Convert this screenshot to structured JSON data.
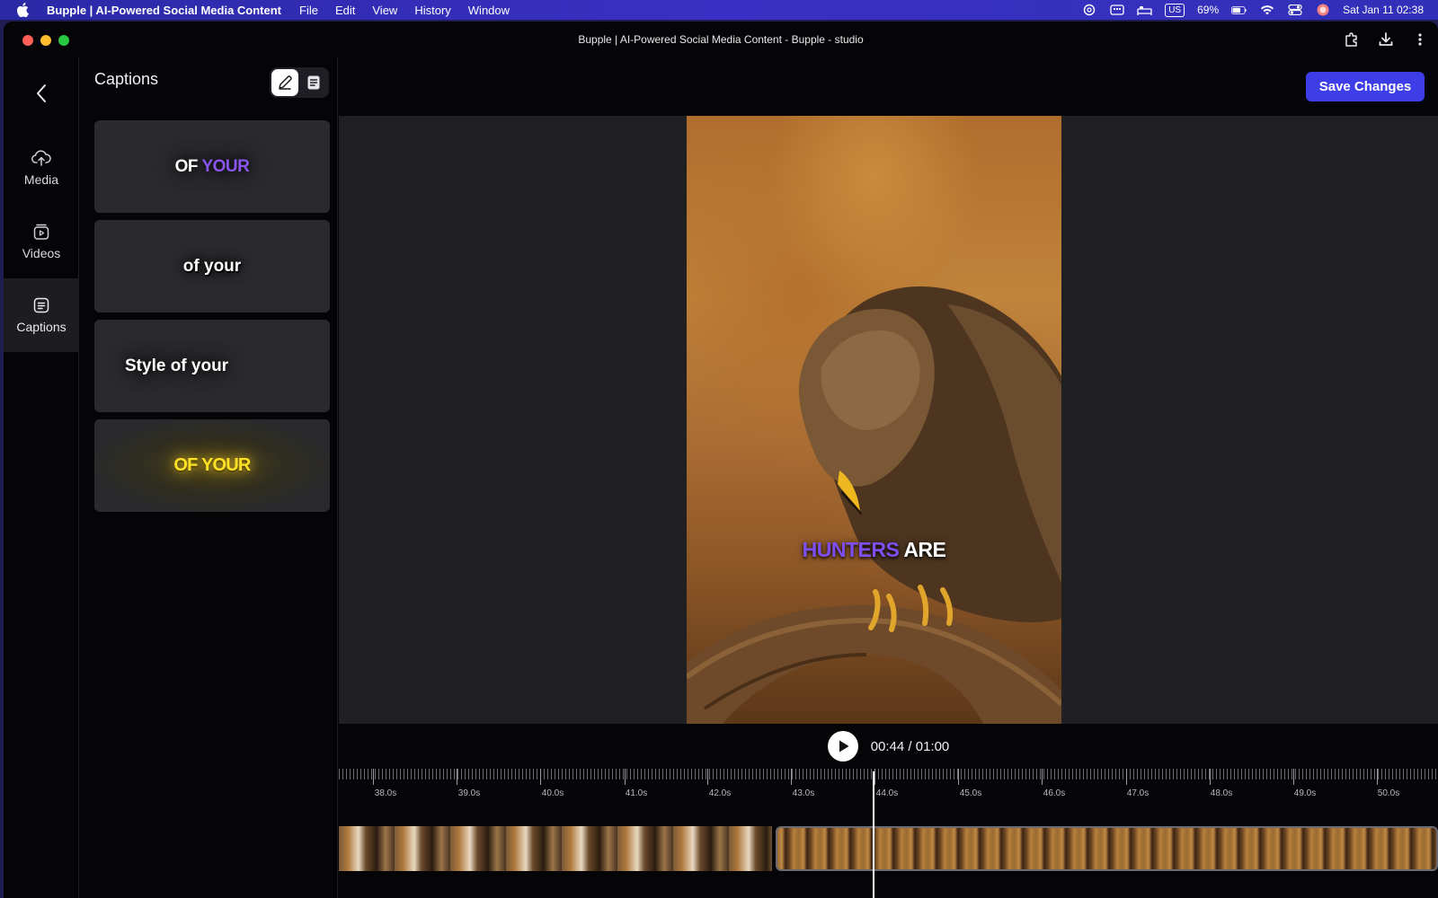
{
  "menubar": {
    "app_name": "Bupple | AI-Powered Social Media Content",
    "menus": [
      "File",
      "Edit",
      "View",
      "History",
      "Window"
    ],
    "input_source": "US",
    "battery": "69%",
    "clock": "Sat Jan 11  02:38"
  },
  "window": {
    "title": "Bupple | AI-Powered Social Media Content - Bupple - studio"
  },
  "rail": {
    "items": [
      {
        "label": "Media",
        "icon": "cloud-upload-icon"
      },
      {
        "label": "Videos",
        "icon": "video-icon"
      },
      {
        "label": "Captions",
        "icon": "captions-icon",
        "active": true
      }
    ]
  },
  "panel": {
    "title": "Captions",
    "caption_styles": [
      {
        "text_a": "OF ",
        "text_b": "YOUR"
      },
      {
        "text": "of your"
      },
      {
        "text": "Style of your"
      },
      {
        "text": "OF YOUR"
      }
    ]
  },
  "main": {
    "save_label": "Save Changes",
    "overlay_hl": "HUNTERS",
    "overlay_rest": " ARE",
    "time": "00:44 / 01:00",
    "ticks": [
      "38.0s",
      "39.0s",
      "40.0s",
      "41.0s",
      "42.0s",
      "43.0s",
      "44.0s",
      "45.0s",
      "46.0s",
      "47.0s",
      "48.0s",
      "49.0s",
      "50.0s"
    ]
  },
  "colors": {
    "accent": "#3e3ee8",
    "caption_highlight": "#8a55f0",
    "caption_yellow": "#ffe227"
  }
}
